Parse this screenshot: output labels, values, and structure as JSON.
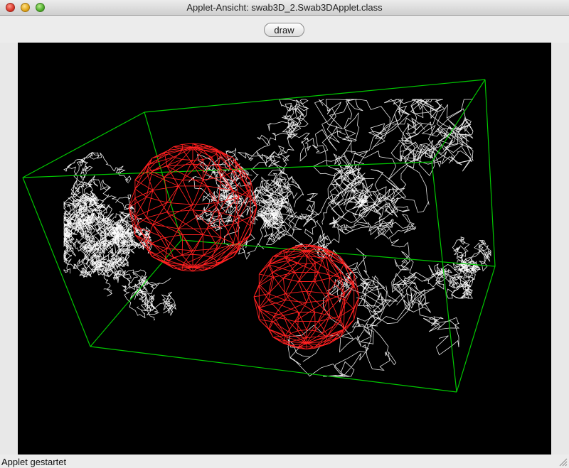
{
  "window": {
    "title": "Applet-Ansicht: swab3D_2.Swab3DApplet.class",
    "controls": [
      "close-icon",
      "minimize-icon",
      "zoom-icon"
    ]
  },
  "toolbar": {
    "draw_label": "draw"
  },
  "status": {
    "text": "Applet gestartet"
  },
  "scene": {
    "background": "#000000",
    "box_color": "#00c800",
    "sphere_color": "#ff2020",
    "trace_color": "#ffffff",
    "sphere_count": 2
  }
}
